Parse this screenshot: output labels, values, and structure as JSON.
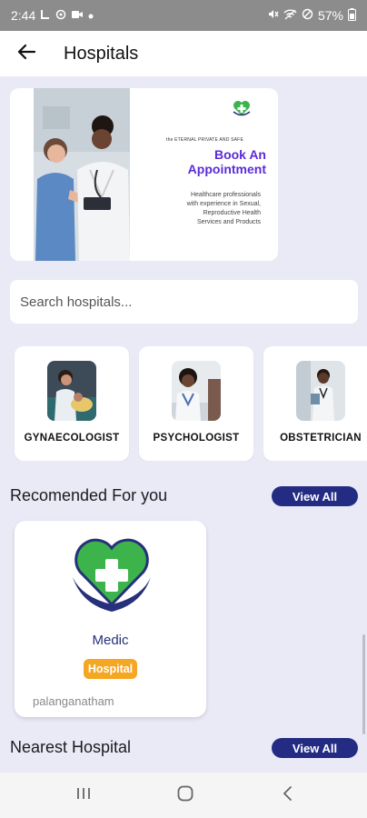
{
  "status_bar": {
    "time": "2:44",
    "battery": "57%",
    "left_icons": [
      "signal-l-icon",
      "location-icon",
      "video-icon",
      "dot-icon"
    ],
    "right_icons": [
      "mute-icon",
      "wifi-icon",
      "dnd-icon",
      "battery-icon"
    ]
  },
  "app_bar": {
    "title": "Hospitals",
    "back_icon": "arrow-left-icon"
  },
  "banner": {
    "small_text": "the ETERNAL PRIVATE AND SAFE",
    "heading_line1": "Book An",
    "heading_line2": "Appointment",
    "subtitle_line1": "Healthcare professionals",
    "subtitle_line2": "with experience in Sexual,",
    "subtitle_line3": "Reproductive Health",
    "subtitle_line4": "Services and Products",
    "heading_color": "#5b2bd8"
  },
  "search": {
    "placeholder": "Search hospitals..."
  },
  "categories": [
    {
      "label": "GYNAECOLOGIST"
    },
    {
      "label": "PSYCHOLOGIST"
    },
    {
      "label": "OBSTETRICIAN"
    }
  ],
  "recommended": {
    "title": "Recomended For you",
    "view_all": "View All",
    "cards": [
      {
        "name": "Medic",
        "badge": "Hospital",
        "location": "palanganatham"
      }
    ]
  },
  "nearest": {
    "title": "Nearest Hospital",
    "view_all": "View All"
  },
  "colors": {
    "page_bg": "#E9EAF6",
    "button_bg": "#232c82",
    "badge_bg": "#f5a623",
    "logo_green": "#3cb44b",
    "logo_navy": "#27307a"
  },
  "nav_bar": {
    "icons": [
      "recent-apps-icon",
      "home-icon",
      "back-icon"
    ]
  }
}
